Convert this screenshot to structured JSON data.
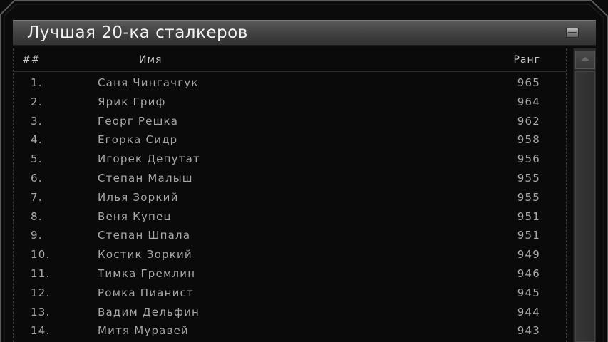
{
  "window": {
    "title": "Лучшая 20-ка сталкеров",
    "icon": "minimize-icon"
  },
  "table": {
    "headers": {
      "number": "##",
      "name": "Имя",
      "rank": "Ранг"
    },
    "rows": [
      {
        "num": "1.",
        "name": "Саня Чингачгук",
        "rank": "965"
      },
      {
        "num": "2.",
        "name": "Ярик Гриф",
        "rank": "964"
      },
      {
        "num": "3.",
        "name": "Георг Решка",
        "rank": "962"
      },
      {
        "num": "4.",
        "name": "Егорка Сидр",
        "rank": "958"
      },
      {
        "num": "5.",
        "name": "Игорек Депутат",
        "rank": "956"
      },
      {
        "num": "6.",
        "name": "Степан Малыш",
        "rank": "955"
      },
      {
        "num": "7.",
        "name": "Илья Зоркий",
        "rank": "955"
      },
      {
        "num": "8.",
        "name": "Веня Купец",
        "rank": "951"
      },
      {
        "num": "9.",
        "name": "Степан Шпала",
        "rank": "951"
      },
      {
        "num": "10.",
        "name": "Костик Зоркий",
        "rank": "949"
      },
      {
        "num": "11.",
        "name": "Тимка Гремлин",
        "rank": "946"
      },
      {
        "num": "12.",
        "name": "Ромка Пианист",
        "rank": "945"
      },
      {
        "num": "13.",
        "name": "Вадим Дельфин",
        "rank": "944"
      },
      {
        "num": "14.",
        "name": "Митя Муравей",
        "rank": "943"
      }
    ]
  },
  "colors": {
    "background": "#0b0b0b",
    "title_bar": "#444444",
    "text": "#a8a8a8",
    "title_text": "#f2f2f2"
  }
}
